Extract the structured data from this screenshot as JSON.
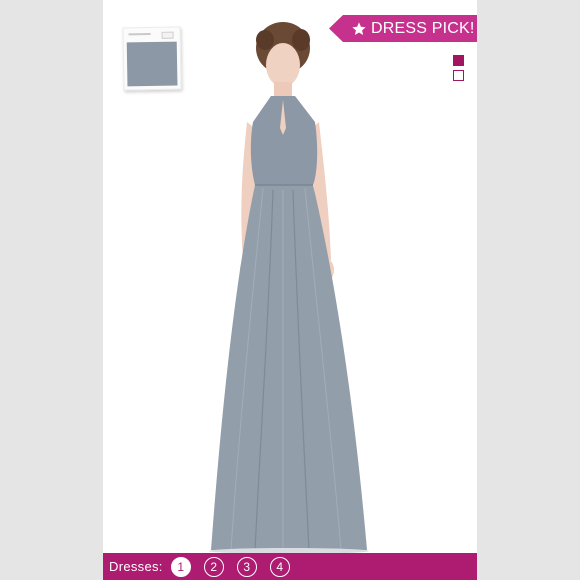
{
  "badge": {
    "label": "DRESS PICK!",
    "icon": "star-icon",
    "color": "#c6318e"
  },
  "swatch": {
    "color": "#8d98a6"
  },
  "color_options": [
    {
      "style": "filled",
      "color": "#a1175f"
    },
    {
      "style": "outline",
      "color": "#a1175f"
    }
  ],
  "dress": {
    "color": "#8d98a6"
  },
  "pager": {
    "label": "Dresses:",
    "pages": [
      "1",
      "2",
      "3",
      "4"
    ],
    "active_page": "1",
    "bar_color": "#ad1c70"
  }
}
